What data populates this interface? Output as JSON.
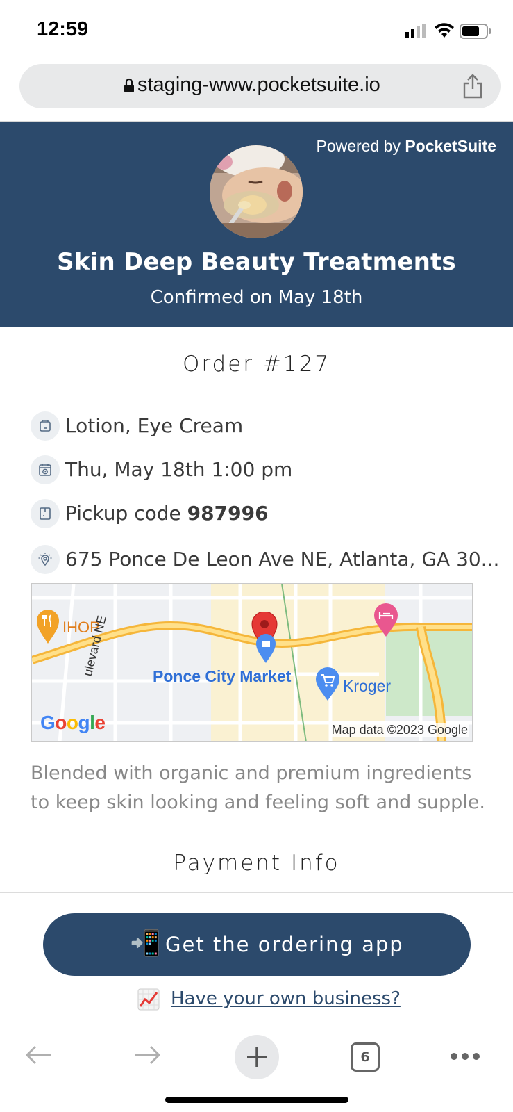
{
  "status_bar": {
    "time": "12:59",
    "icons": [
      "cellular-signal-icon",
      "wifi-icon",
      "battery-icon"
    ]
  },
  "browser": {
    "url": "staging-www.pocketsuite.io",
    "tab_count": "6"
  },
  "header": {
    "powered_prefix": "Powered by",
    "powered_brand": "PocketSuite",
    "business_name": "Skin Deep Beauty Treatments",
    "confirmed": "Confirmed on May 18th",
    "bg_color": "#2c4a6c"
  },
  "order": {
    "title": "Order #127",
    "items": "Lotion, Eye Cream",
    "datetime": "Thu, May 18th 1:00 pm",
    "pickup_prefix": "Pickup code",
    "pickup_code": "987996",
    "address": "675 Ponce De Leon Ave NE, Atlanta, GA 30..."
  },
  "map": {
    "labels": {
      "ihop": "IHOP",
      "street": "ulevard NE",
      "ponce": "Ponce City Market",
      "kroger": "Kroger",
      "google": "Google",
      "attribution": "Map data ©2023 Google"
    }
  },
  "description": "Blended with organic and premium ingredients to keep skin looking and feeling soft and supple.",
  "payment": {
    "title": "Payment Info"
  },
  "cta": {
    "emoji": "📲",
    "label": "Get the ordering app",
    "color": "#2c4a6c"
  },
  "business_link": {
    "label": "Have your own business?"
  }
}
